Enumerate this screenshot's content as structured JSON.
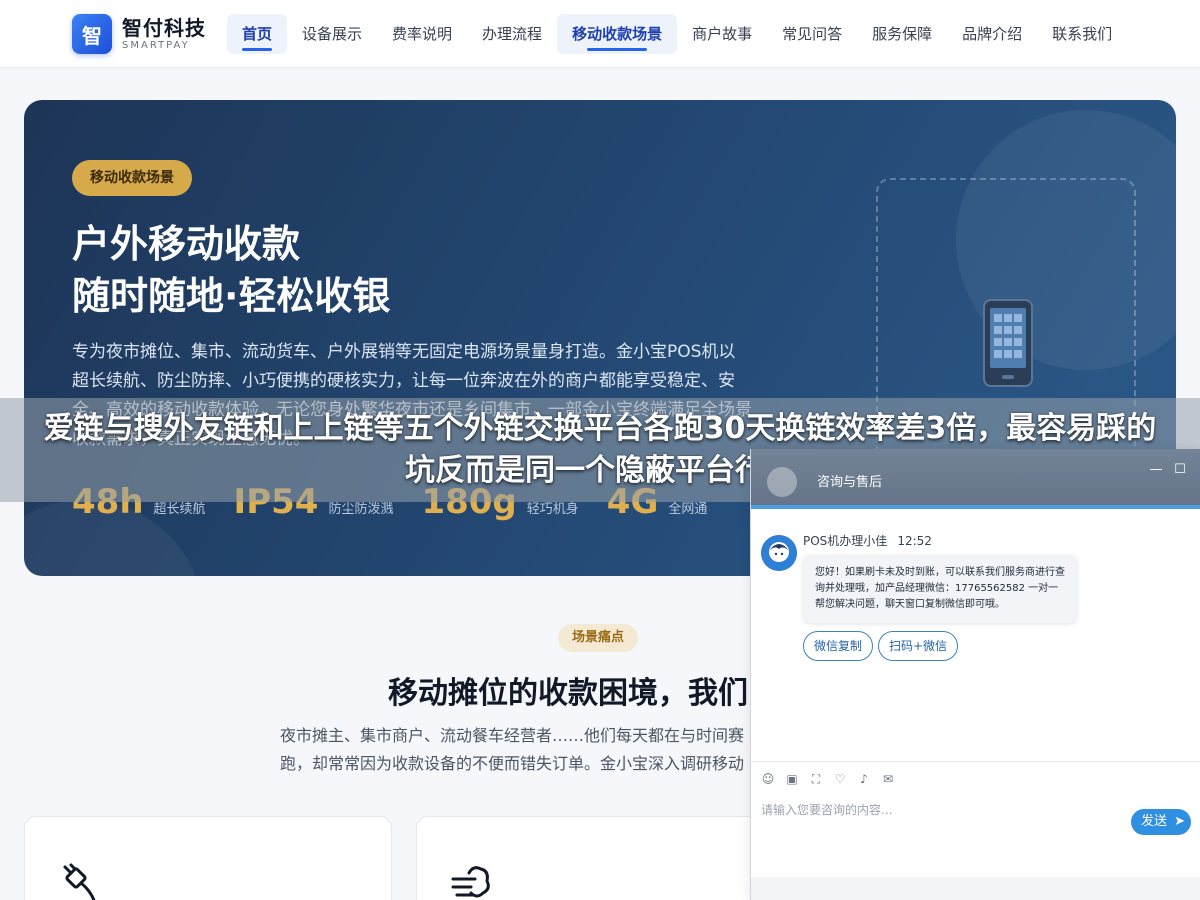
{
  "header": {
    "logo_mark": "智",
    "logo_cn": "智付科技",
    "logo_en": "SMARTPAY",
    "nav": [
      {
        "label": "首页",
        "active": true
      },
      {
        "label": "设备展示",
        "active": false
      },
      {
        "label": "费率说明",
        "active": false
      },
      {
        "label": "办理流程",
        "active": false
      },
      {
        "label": "移动收款场景",
        "active": true
      },
      {
        "label": "商户故事",
        "active": false
      },
      {
        "label": "常见问答",
        "active": false
      },
      {
        "label": "服务保障",
        "active": false
      },
      {
        "label": "品牌介绍",
        "active": false
      },
      {
        "label": "联系我们",
        "active": false
      }
    ]
  },
  "hero": {
    "tag": "移动收款场景",
    "title_line1": "户外移动收款",
    "title_line2": "随时随地·轻松收银",
    "desc": "专为夜市摊位、集市、流动货车、户外展销等无固定电源场景量身打造。金小宝POS机以超长续航、防尘防摔、小巧便携的硬核实力，让每一位奔波在外的商户都能享受稳定、安全、高效的移动收款体验，无论您身处繁华夜市还是乡间集市，一部金小宝终端满足全场景收款需求，真正实现生意无忧。",
    "stats": [
      {
        "value": "48h",
        "label": "超长续航"
      },
      {
        "value": "IP54",
        "label": "防尘防泼溅"
      },
      {
        "value": "180g",
        "label": "轻巧机身"
      },
      {
        "value": "4G",
        "label": "全网通"
      }
    ],
    "colors": {
      "stat": "#e0b04f",
      "tag_bg": "#d6a94a"
    }
  },
  "banner": {
    "text": "爱链与搜外友链和上上链等五个外链交换平台各跑30天换链效率差3倍，最容易踩的坑反而是同一个隐蔽平台行为"
  },
  "section": {
    "tag": "场景痛点",
    "title": "移动摊位的收款困境，我们",
    "desc": "夜市摊主、集市商户、流动餐车经营者……他们每天都在与时间赛跑，却常常因为收款设备的不便而错失订单。金小宝深入调研移动商户的真实需求，针对性地"
  },
  "chat": {
    "header_title": "咨询与售后",
    "agent_name": "POS机办理小佳",
    "time": "12:52",
    "message": "您好！如果刷卡未及时到账，可以联系我们服务商进行查询并处理哦，加产品经理微信：17765562582 一对一帮您解决问题，聊天窗口复制微信即可哦。",
    "btn_copy": "微信复制",
    "btn_scan": "扫码+微信",
    "input_placeholder": "请输入您要咨询的内容...",
    "send_label": "发送",
    "colors": {
      "accent": "#2f8fe0"
    }
  }
}
